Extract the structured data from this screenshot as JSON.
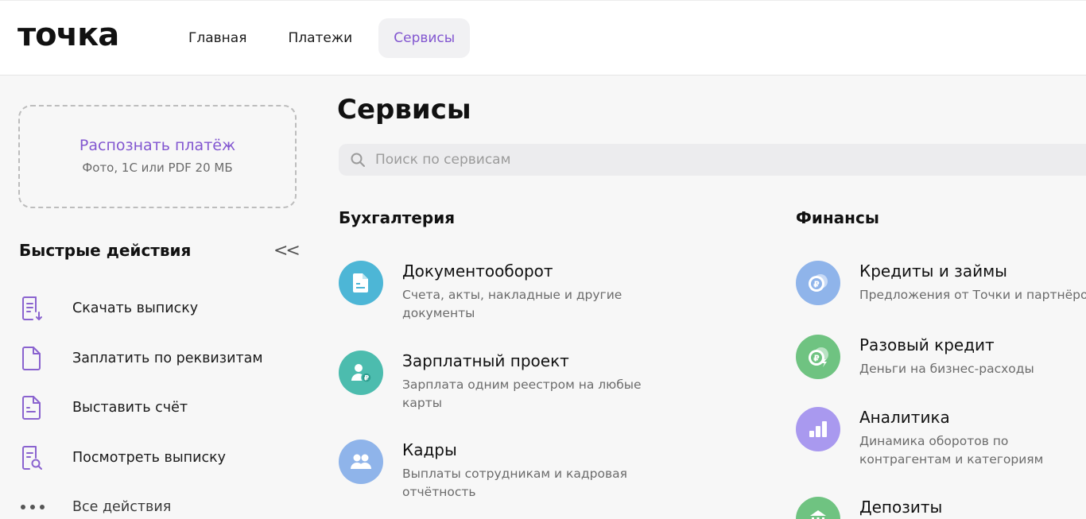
{
  "header": {
    "logo": "точка",
    "nav": [
      {
        "label": "Главная",
        "active": false
      },
      {
        "label": "Платежи",
        "active": false
      },
      {
        "label": "Сервисы",
        "active": true
      }
    ]
  },
  "sidebar": {
    "upload": {
      "title": "Распознать платёж",
      "subtitle": "Фото, 1С или PDF 20 МБ"
    },
    "quick_actions": {
      "title": "Быстрые действия",
      "collapse_glyph": "<<",
      "items": [
        {
          "label": "Скачать выписку",
          "icon": "document-download-icon"
        },
        {
          "label": "Заплатить по реквизитам",
          "icon": "document-icon"
        },
        {
          "label": "Выставить счёт",
          "icon": "invoice-icon"
        },
        {
          "label": "Посмотреть выписку",
          "icon": "document-search-icon"
        },
        {
          "label": "Все действия",
          "icon": "more-dots-icon"
        }
      ]
    }
  },
  "main": {
    "title": "Сервисы",
    "search": {
      "placeholder": "Поиск по сервисам",
      "value": ""
    },
    "sections": [
      {
        "title": "Бухгалтерия",
        "services": [
          {
            "title": "Документооборот",
            "description": "Счета, акты, накладные и другие документы",
            "icon": "document-icon",
            "color": "#4db6d6"
          },
          {
            "title": "Зарплатный проект",
            "description": "Зарплата одним реестром на любые карты",
            "icon": "employee-ruble-icon",
            "color": "#4cbcae"
          },
          {
            "title": "Кадры",
            "description": "Выплаты сотрудникам и кадровая отчётность",
            "icon": "people-icon",
            "color": "#8fb4ea"
          }
        ]
      },
      {
        "title": "Финансы",
        "services": [
          {
            "title": "Кредиты и займы",
            "description": "Предложения от Точки и партнёров",
            "icon": "coins-ruble-icon",
            "color": "#8fb4ea"
          },
          {
            "title": "Разовый кредит",
            "description": "Деньги на бизнес-расходы",
            "icon": "coin-lightning-icon",
            "color": "#6fc381"
          },
          {
            "title": "Аналитика",
            "description": "Динамика оборотов по контрагентам и категориям платежей",
            "icon": "bar-chart-icon",
            "color": "#a999ef"
          },
          {
            "title": "Депозиты",
            "description": "",
            "icon": "deposit-icon",
            "color": "#6fc381"
          }
        ]
      }
    ]
  },
  "colors": {
    "accent": "#8256d0",
    "icon_purple": "#8a63cf"
  }
}
